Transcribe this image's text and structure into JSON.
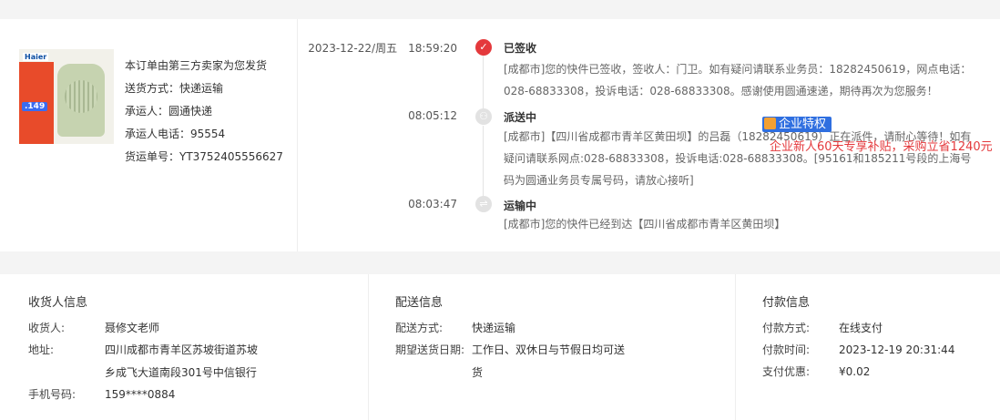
{
  "product": {
    "brand": "Haier",
    "price_tag": ".149",
    "notice": "本订单由第三方卖家为您发货",
    "shipping_method": "送货方式：快递运输",
    "carrier": "承运人：圆通快递",
    "carrier_phone": "承运人电话：95554",
    "tracking_no": "货运单号：YT3752405556627"
  },
  "timeline": [
    {
      "date": "2023-12-22/周五",
      "time": "18:59:20",
      "status": "已签收",
      "icon": "check-icon",
      "desc": "[成都市]您的快件已签收，签收人：门卫。如有疑问请联系业务员：18282450619，网点电话：028-68833308，投诉电话：028-68833308。感谢使用圆通速递，期待再次为您服务！"
    },
    {
      "date": "",
      "time": "08:05:12",
      "status": "派送中",
      "icon": "courier-icon",
      "desc": "[成都市]【四川省成都市青羊区黄田坝】的吕磊（18282450619）正在派件，请耐心等待！如有疑问请联系网点:028-68833308，投诉电话:028-68833308。[95161和185211号段的上海号码为圆通业务员专属号码，请放心接听]"
    },
    {
      "date": "",
      "time": "08:03:47",
      "status": "运输中",
      "icon": "truck-icon",
      "desc": "[成都市]您的快件已经到达【四川省成都市青羊区黄田坝】"
    }
  ],
  "consignee": {
    "title": "收货人信息",
    "name_label": "收货人:",
    "name": "聂修文老师",
    "address_label": "地址:",
    "address_line1": "四川成都市青羊区苏坡街道苏坡",
    "address_line2": "乡成飞大道南段301号中信银行",
    "phone_label": "手机号码:",
    "phone": "159****0884"
  },
  "delivery": {
    "title": "配送信息",
    "method_label": "配送方式:",
    "method": "快递运输",
    "expected_label": "期望送货日期:",
    "expected_line1": "工作日、双休日与节假日均可送",
    "expected_line2": "货"
  },
  "payment": {
    "title": "付款信息",
    "method_label": "付款方式:",
    "method": "在线支付",
    "time_label": "付款时间:",
    "time": "2023-12-19 20:31:44",
    "discount_label": "支付优惠:",
    "discount": "¥0.02",
    "privilege_badge": "企业特权",
    "promo_text": "企业新人60天专享补贴，采购立省1240元"
  },
  "colors": {
    "accent_red": "#e4393c",
    "badge_blue": "#2f6fe0",
    "divider": "#eeeeee",
    "page_bg": "#f4f4f4"
  }
}
